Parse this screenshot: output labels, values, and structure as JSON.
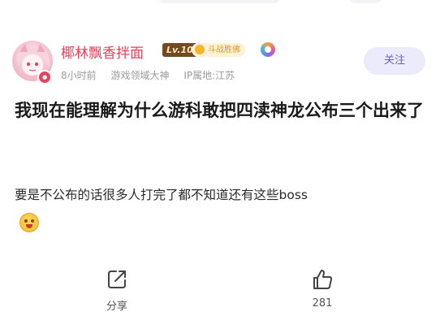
{
  "author": {
    "name": "椰林飘香拌面",
    "level": "Lv.10",
    "medal": "斗战胜佛",
    "time": "8小时前",
    "title_badge": "游戏领域大神",
    "ip": "IP属地:江苏"
  },
  "follow_label": "关注",
  "post": {
    "title": "我现在能理解为什么游科敢把四渎神龙公布三个出来了",
    "body": "要是不公布的话很多人打完了都不知道还有这些boss"
  },
  "actions": {
    "share_label": "分享",
    "like_count": "281"
  },
  "colors": {
    "username": "#e8435a",
    "follow_bg": "#ecebfb",
    "follow_text": "#6a5fcf",
    "meta": "#9a9a9a"
  }
}
